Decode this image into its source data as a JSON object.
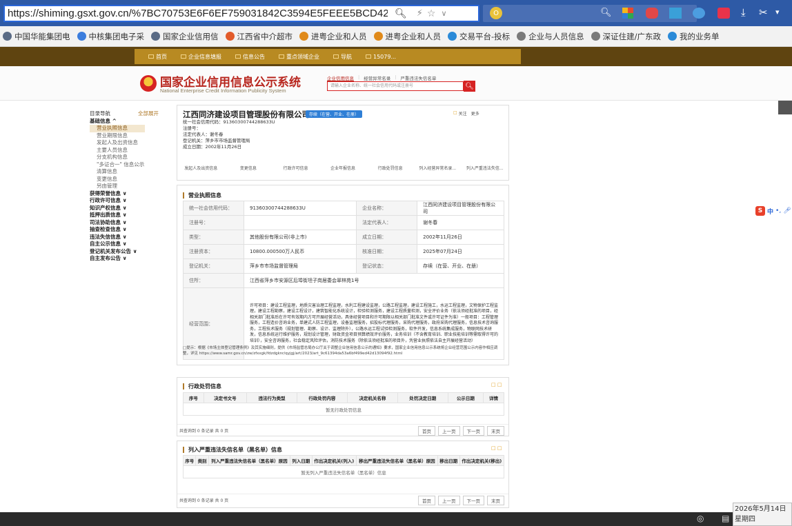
{
  "browser": {
    "url": "https://shiming.gsxt.gov.cn/%7BC70753E6F6EF759031842C3594E5FEEE5BCD42E3FA6C",
    "bookmarks": [
      {
        "label": "中国华能集团电",
        "color": "#5a6b85"
      },
      {
        "label": "中核集团电子采",
        "color": "#3b7ddd"
      },
      {
        "label": "国家企业信用信",
        "color": "#5a6b85"
      },
      {
        "label": "江西省中介超市",
        "color": "#e25b2a"
      },
      {
        "label": "进粤企业和人员",
        "color": "#e08a1a"
      },
      {
        "label": "进粤企业和人员",
        "color": "#e08a1a"
      },
      {
        "label": "交易平台-投标",
        "color": "#2a8ad8"
      },
      {
        "label": "企业与人员信息",
        "color": "#7a7a7a"
      },
      {
        "label": "深证住建/广东政",
        "color": "#7a7a7a"
      },
      {
        "label": "我的业务单",
        "color": "#2a8ad8"
      }
    ]
  },
  "sitenav": {
    "items": [
      "首页",
      "企业信息填报",
      "信息公告",
      "重点领域企业",
      "导航",
      "15079..."
    ]
  },
  "header": {
    "title_cn": "国家企业信用信息公示系统",
    "title_en": "National Enterprise Credit Information Publicity System",
    "search_tabs": [
      "企业信用信息",
      "经营异常名录",
      "严重违法失信名单"
    ],
    "search_placeholder": "请输入企业名称、统一社会信用代码或注册号"
  },
  "side": {
    "nav_title": "目录导航",
    "expand_all": "全部展开",
    "groups": [
      {
        "label": "基础信息 ^",
        "bold": true
      },
      {
        "label": "营业执照信息",
        "sub": true,
        "active": true
      },
      {
        "label": "营业期限信息",
        "sub": true
      },
      {
        "label": "发起人及出资信息",
        "sub": true
      },
      {
        "label": "主要人员信息",
        "sub": true
      },
      {
        "label": "分支机构信息",
        "sub": true
      },
      {
        "label": "\"多证合一\" 信息公示",
        "sub": true
      },
      {
        "label": "清算信息",
        "sub": true
      },
      {
        "label": "变更信息",
        "sub": true
      },
      {
        "label": "另由管理",
        "sub": true
      },
      {
        "label": "获得荣誉信息 ∨",
        "bold": true
      },
      {
        "label": "行政许可信息 ∨",
        "bold": true
      },
      {
        "label": "知识产权信息 ∨",
        "bold": true
      },
      {
        "label": "抵押出质信息 ∨",
        "bold": true
      },
      {
        "label": "司法协助信息 ∨",
        "bold": true
      },
      {
        "label": "抽查检查信息 ∨",
        "bold": true
      },
      {
        "label": "违法失信信息 ∨",
        "bold": true
      },
      {
        "label": "自主公示信息 ∨",
        "bold": true
      },
      {
        "label": "登记机关发布公告 ∨",
        "bold": true
      },
      {
        "label": "自主发布公告 ∨",
        "bold": true
      }
    ]
  },
  "company": {
    "name": "江西同济建设项目管理股份有限公司",
    "status_badge": "存续（在营、开业、在册）",
    "follow": "关注",
    "more": "更多",
    "credit_code_line": "统一社会信用代码：91360300744288633U",
    "reg_no_line": "注册号：",
    "legal_rep_line": "法定代表人：谢冬春",
    "reg_authority_line": "登记机关：萍乡市市场监督管理局",
    "est_date_line": "成立日期：2002年11月26日",
    "tabs": [
      "发起人及出资信息",
      "变更信息",
      "行政许可信息",
      "企业年报信息",
      "行政处罚信息",
      "列入经营异常名录...",
      "列入严重违法失信..."
    ]
  },
  "license": {
    "title": "营业执照信息",
    "rows": [
      [
        "统一社会信用代码：",
        "91360300744288633U",
        "企业名称：",
        "江西同济建设项目管理股份有限公司"
      ],
      [
        "注册号：",
        "",
        "法定代表人：",
        "谢冬春"
      ],
      [
        "类型：",
        "其他股份有限公司(非上市)",
        "成立日期：",
        "2002年11月26日"
      ],
      [
        "注册资本：",
        "10800.000500万人民币",
        "核准日期：",
        "2025年07月24日"
      ],
      [
        "登记机关：",
        "萍乡市市场监督管理局",
        "登记状态：",
        "存续（在营、开业、在册）"
      ]
    ],
    "address_label": "住所：",
    "address": "江西省萍乡市安源区后埠街坦子岗居委会翠林苑1号",
    "scope_label": "经营范围：",
    "scope": "许可项目：建设工程监理，地质灾害治理工程监理，水利工程建设监理，公路工程监理，建设工程施工，水运工程监理，文物保护工程监理，建设工程勘察，建设工程设计，建筑智能化系统设计，检验检测服务，建设工程质量检测，安全评价业务（依法须经批准的项目，经相关部门批准后在许可有效期内方可开展经营活动，具体经营项目和许可期限以相关部门批准文件或许可证件为准）一般项目：工程管理服务，工程造价咨询业务，单建式人防工程监理，设备监理服务，招投标代理服务，采购代理服务，政府采购代理服务，信息技术咨询服务，工程技术服务（规划管理、勘察、设计、监理除外），公路水运工程试验检测服务，软件开发，信息系统集成服务，物联网技术研发，信息系统运行维护服务，规划设计管理，财政资金项目预算绩效评价服务，业务培训（不含教育培训、职业技能培训等需取得许可的培训），安全咨询服务，社会稳定风险评估，消防技术服务（除依法须经批准的项目外，凭营业执照依法自主开展经营活动）",
    "notice": "□提示：根据《市场主体登记管理条例》及其实施细则，提供《市场监管总局办公厅关于调整企业信用信息公示的通知》要求，国家企业信用信息公示系统将企业经营范围公示内容作相应调整，详见 https://www.samr.gov.cn/zw/zfxxgk/fdzdgknr/qyjgj/art/2023/art_9c61394da53a6bf499ed42d13094f92.html"
  },
  "penalty": {
    "title": "行政处罚信息",
    "headers": [
      "序号",
      "决定书文号",
      "违法行为类型",
      "行政处罚内容",
      "决定机关名称",
      "处罚决定日期",
      "公示日期",
      "详情"
    ],
    "empty": "暂无行政处罚信息",
    "count": "共查询到 0 条记录 共 0 页",
    "pager": [
      "首页",
      "上一页",
      "下一页",
      "末页"
    ]
  },
  "blacklist": {
    "title": "列入严重违法失信名单（黑名单）信息",
    "headers": [
      "序号",
      "类别",
      "列入严重违法失信名单（黑名单）原因",
      "列入日期",
      "作出决定机关(列入)",
      "移出严重违法失信名单（黑名单）原因",
      "移出日期",
      "作出决定机关(移出)"
    ],
    "empty": "暂无列入严重违法失信名单（黑名单）信息",
    "count": "共查询到 0 条记录 共 0 页",
    "pager": [
      "首页",
      "上一页",
      "下一页",
      "末页"
    ]
  },
  "taskbar": {
    "date": "2026年5月14日",
    "weekday": "星期四"
  },
  "colors": {
    "chrome": "#2e5aa6",
    "nav_dark": "#5f4410",
    "nav_gold": "#b88a22",
    "accent_red": "#d62323",
    "badge_blue": "#2f7fd6",
    "section_bar": "#b07a2a"
  }
}
